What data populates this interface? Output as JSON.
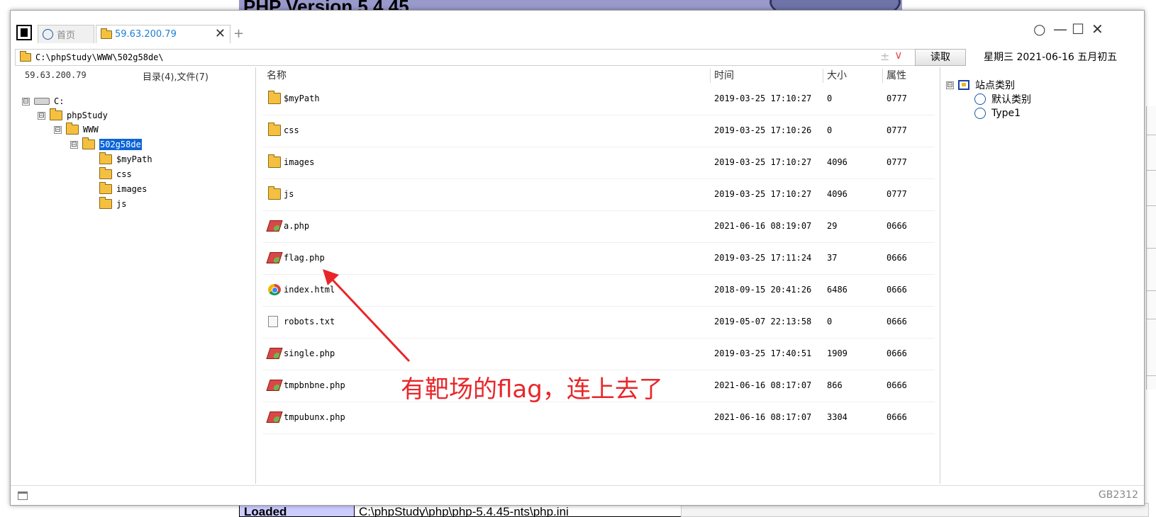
{
  "background": {
    "phpinfo_title": "PHP Version 5.4.45",
    "loaded_label": "Loaded",
    "loaded_value": "C:\\phpStudy\\php\\php-5.4.45-nts\\php.ini"
  },
  "tabs": {
    "home_label": "首页",
    "active_label": "59.63.200.79",
    "close": "✕",
    "add": "+"
  },
  "window_controls": {
    "circle": "○",
    "minimize": "—",
    "maximize": "☐",
    "close": "✕"
  },
  "address": {
    "path": "C:\\phpStudy\\WWW\\502g58de\\",
    "plus": "±",
    "dropdown": "∨",
    "read_button": "读取"
  },
  "date_display": "星期三 2021-06-16 五月初五",
  "left_pane": {
    "host": "59.63.200.79",
    "summary": "目录(4),文件(7)",
    "tree": [
      {
        "label": "C:",
        "toggle": "⊟"
      },
      {
        "label": "phpStudy",
        "toggle": "⊟"
      },
      {
        "label": "WWW",
        "toggle": "⊟"
      },
      {
        "label": "502g58de",
        "toggle": "⊟",
        "selected": true
      },
      {
        "label": "$myPath"
      },
      {
        "label": "css"
      },
      {
        "label": "images"
      },
      {
        "label": "js"
      }
    ]
  },
  "file_list": {
    "columns": {
      "name": "名称",
      "time": "时间",
      "size": "大小",
      "attr": "属性"
    },
    "rows": [
      {
        "icon": "folder-icon",
        "name": "$myPath",
        "time": "2019-03-25 17:10:27",
        "size": "0",
        "attr": "0777"
      },
      {
        "icon": "folder-icon",
        "name": "css",
        "time": "2019-03-25 17:10:26",
        "size": "0",
        "attr": "0777"
      },
      {
        "icon": "folder-icon",
        "name": "images",
        "time": "2019-03-25 17:10:27",
        "size": "4096",
        "attr": "0777"
      },
      {
        "icon": "folder-icon",
        "name": "js",
        "time": "2019-03-25 17:10:27",
        "size": "4096",
        "attr": "0777"
      },
      {
        "icon": "php-file-icon",
        "name": "a.php",
        "time": "2021-06-16 08:19:07",
        "size": "29",
        "attr": "0666"
      },
      {
        "icon": "php-file-icon",
        "name": "flag.php",
        "time": "2019-03-25 17:11:24",
        "size": "37",
        "attr": "0666"
      },
      {
        "icon": "chrome-html-icon",
        "name": "index.html",
        "time": "2018-09-15 20:41:26",
        "size": "6486",
        "attr": "0666"
      },
      {
        "icon": "text-file-icon",
        "name": "robots.txt",
        "time": "2019-05-07 22:13:58",
        "size": "0",
        "attr": "0666"
      },
      {
        "icon": "php-file-icon",
        "name": "single.php",
        "time": "2019-03-25 17:40:51",
        "size": "1909",
        "attr": "0666"
      },
      {
        "icon": "php-file-icon",
        "name": "tmpbnbne.php",
        "time": "2021-06-16 08:17:07",
        "size": "866",
        "attr": "0666"
      },
      {
        "icon": "php-file-icon",
        "name": "tmpubunx.php",
        "time": "2021-06-16 08:17:07",
        "size": "3304",
        "attr": "0666"
      }
    ]
  },
  "right_pane": {
    "root": {
      "label": "站点类别",
      "toggle": "⊟"
    },
    "items": [
      {
        "label": "默认类别"
      },
      {
        "label": "Type1"
      }
    ]
  },
  "status_bar": {
    "encoding": "GB2312"
  },
  "annotation": {
    "text": "有靶场的flag，连上去了",
    "color": "#e8262a"
  }
}
